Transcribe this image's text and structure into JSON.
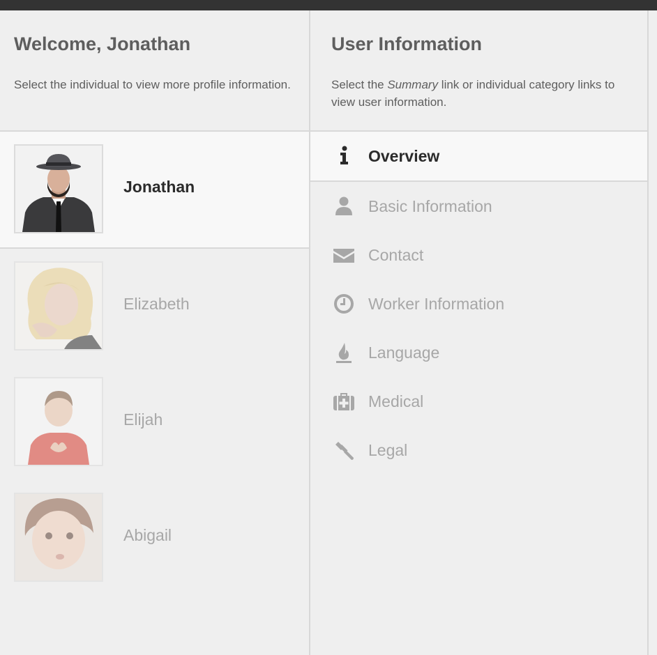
{
  "left_panel": {
    "title": "Welcome, Jonathan",
    "description": "Select the individual to view more profile information.",
    "people": [
      {
        "name": "Jonathan",
        "active": true,
        "icon": "person-photo"
      },
      {
        "name": "Elizabeth",
        "active": false,
        "icon": "person-photo"
      },
      {
        "name": "Elijah",
        "active": false,
        "icon": "person-photo"
      },
      {
        "name": "Abigail",
        "active": false,
        "icon": "person-photo"
      }
    ]
  },
  "right_panel": {
    "title": "User Information",
    "description_pre": "Select the ",
    "description_em": "Summary",
    "description_post": " link or individual category links to view user information.",
    "categories": [
      {
        "label": "Overview",
        "icon": "info-icon",
        "active": true
      },
      {
        "label": "Basic Information",
        "icon": "user-icon",
        "active": false
      },
      {
        "label": "Contact",
        "icon": "envelope-icon",
        "active": false
      },
      {
        "label": "Worker Information",
        "icon": "clock-icon",
        "active": false
      },
      {
        "label": "Language",
        "icon": "flame-icon",
        "active": false
      },
      {
        "label": "Medical",
        "icon": "medkit-icon",
        "active": false
      },
      {
        "label": "Legal",
        "icon": "gavel-icon",
        "active": false
      }
    ]
  },
  "colors": {
    "topbar": "#333333",
    "background": "#efefef",
    "active_row": "#f8f8f8",
    "divider": "#d8d8d8",
    "active_text": "#2b2b2b",
    "inactive_text": "#a7a7a7",
    "header_text": "#5e5e5e"
  }
}
